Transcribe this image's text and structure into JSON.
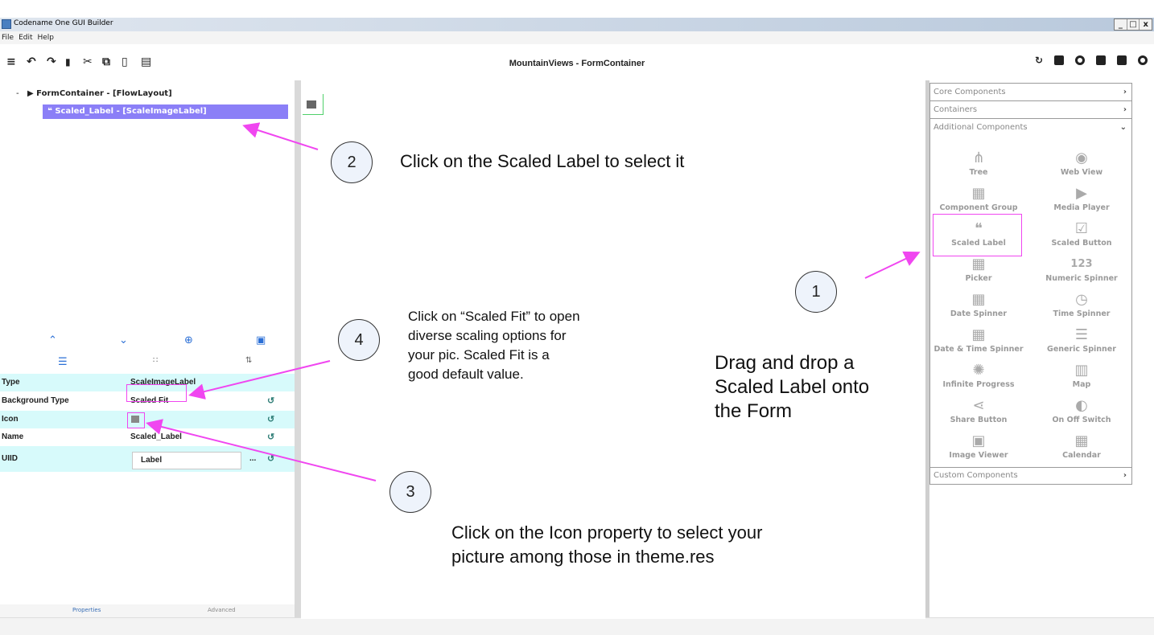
{
  "window": {
    "title": "Codename One GUI Builder",
    "controls": [
      "_",
      "□",
      "x"
    ]
  },
  "menu": [
    "File",
    "Edit",
    "Help"
  ],
  "toolbar": {
    "doc_title": "MountainViews - FormContainer"
  },
  "tree": {
    "root": "FormContainer - [FlowLayout]",
    "collapse": "-",
    "child": "Scaled_Label - [ScaleImageLabel]"
  },
  "properties": [
    {
      "name": "Type",
      "value": "ScaleImageLabel"
    },
    {
      "name": "Background Type",
      "value": "Scaled Fit"
    },
    {
      "name": "Icon",
      "value": ""
    },
    {
      "name": "Name",
      "value": "Scaled_Label"
    },
    {
      "name": "UIID",
      "value": "Label"
    }
  ],
  "uiid_ellipsis": "...",
  "bottom_tabs": [
    "Properties",
    "Advanced"
  ],
  "palette": {
    "core": "Core Components",
    "containers": "Containers",
    "additional": "Additional Components",
    "custom": "Custom Components",
    "items": [
      {
        "label": "Tree",
        "icon": "tree-icon"
      },
      {
        "label": "Web View",
        "icon": "globe-icon"
      },
      {
        "label": "Component Group",
        "icon": "grid-icon"
      },
      {
        "label": "Media Player",
        "icon": "play-icon"
      },
      {
        "label": "Scaled Label",
        "icon": "quote-icon"
      },
      {
        "label": "Scaled Button",
        "icon": "checkbox-icon"
      },
      {
        "label": "Picker",
        "icon": "calendar-icon"
      },
      {
        "label": "Numeric Spinner",
        "icon": "number-icon"
      },
      {
        "label": "Date Spinner",
        "icon": "calendar-icon"
      },
      {
        "label": "Time Spinner",
        "icon": "clock-icon"
      },
      {
        "label": "Date & Time Spinner",
        "icon": "calendar-icon"
      },
      {
        "label": "Generic Spinner",
        "icon": "list-icon"
      },
      {
        "label": "Infinite Progress",
        "icon": "spinner-icon"
      },
      {
        "label": "Map",
        "icon": "map-icon"
      },
      {
        "label": "Share Button",
        "icon": "share-icon"
      },
      {
        "label": "On Off Switch",
        "icon": "toggle-icon"
      },
      {
        "label": "Image Viewer",
        "icon": "image-icon"
      },
      {
        "label": "Calendar",
        "icon": "calendar-icon"
      }
    ],
    "numeric_glyph": "123"
  },
  "annotations": {
    "step1": {
      "num": "1",
      "text": [
        "Drag and drop a",
        "Scaled Label onto",
        "the Form"
      ]
    },
    "step2": {
      "num": "2",
      "text": "Click on the Scaled Label to select it"
    },
    "step3": {
      "num": "3",
      "text": [
        "Click on the Icon property to select your",
        "picture among those in theme.res"
      ]
    },
    "step4": {
      "num": "4",
      "text": [
        "Click on “Scaled Fit” to open",
        "diverse scaling options for",
        "your pic. Scaled Fit is a",
        "good default value."
      ]
    }
  },
  "colors": {
    "accent_magenta": "#f046f0",
    "selection": "#8b7ff7",
    "property_row": "#d7fafb",
    "canvas_selection": "#4fd06a"
  }
}
